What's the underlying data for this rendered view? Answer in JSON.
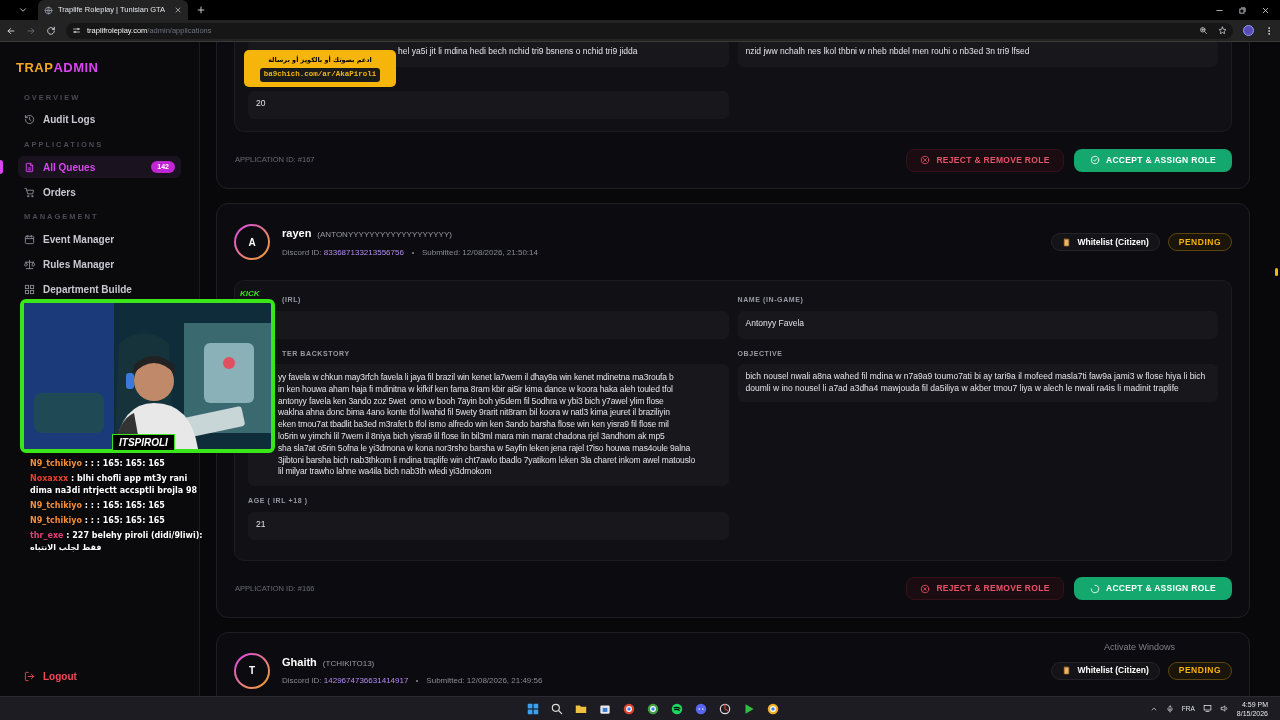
{
  "browser": {
    "tab_title": "Traplife Roleplay | Tunisian GTA",
    "url_host": "traplifroleplay.com",
    "url_path": "/admin/applications"
  },
  "sidebar": {
    "logo": [
      "TRAP",
      "ADMIN"
    ],
    "sections": [
      {
        "title": "OVERVIEW",
        "items": [
          {
            "label": "Audit Logs",
            "selected": false
          }
        ]
      },
      {
        "title": "APPLICATIONS",
        "items": [
          {
            "label": "All Queues",
            "selected": true,
            "badge": "142"
          },
          {
            "label": "Orders",
            "selected": false
          }
        ]
      },
      {
        "title": "MANAGEMENT",
        "items": [
          {
            "label": "Event Manager",
            "selected": false
          },
          {
            "label": "Rules Manager",
            "selected": false
          },
          {
            "label": "Department Builde",
            "selected": false
          }
        ]
      }
    ],
    "logout": "Logout"
  },
  "applications": [
    {
      "fields": [
        {
          "value": "hel ya5i jit li mdina hedi bech nchid tri9 bsnens o nchid tri9 jidda"
        },
        {
          "value": "nzid jww nchalh nes lkol thbni w nheb nbdel men rouhi o nb3ed 3n tri9 lfsed"
        },
        {
          "value": "20"
        }
      ],
      "application_id": "APPLICATION ID: #167",
      "actions": [
        {
          "kind": "reject",
          "label": "REJECT & REMOVE ROLE"
        },
        {
          "kind": "accept",
          "label": "ACCEPT & ASSIGN ROLE",
          "loading": false
        }
      ]
    },
    {
      "initial": "A",
      "name": "rayen",
      "alias": "(ANTONYYYYYYYYYYYYYYYYYYY)",
      "discord_label": "Discord ID:",
      "discord_id": "833687133213556756",
      "submitted": "Submitted: 12/08/2026, 21:50:14",
      "type": "Whitelist (Citizen)",
      "status": "PENDING",
      "fields": [
        {
          "label": "(IRL)"
        },
        {
          "label": "NAME (IN-GAME)",
          "value": "Antonyy Favela"
        },
        {
          "label": "TER BACKSTORY",
          "lines": [
            "yy favela w chkun may3rfch favela li jaya fil brazil win kenet la7wem il dhay9a win kenet mdinetna ma3roufa b",
            "in ken houwa aham haja fi mdinitna w kifkif ken fama 8ram kbir ai5ir kima dance w koora haka aleh touled tfol",
            "antonyy favela ken 3ando zoz 5wet  omo w booh 7ayin boh yi5dem fil 5odhra w ybi3 bich y7awel ylim flose",
            "waklna ahna donc bima 4ano konte tfol lwahid fil 5wety 9rarit nit8ram bil koora w natl3 kima jeuret il braziliyin",
            "eken tmou7at tbadlit ba3ed m3rafet b tfol ismo alfredo win ken 3ando barsha flose win ken yisra9 fil flose mil",
            "lo5rin w yimchi lil 7wem il 8niya bich yisra9 lil flose lin bil3ml mara min marat chadona rjel 3andhom ak mp5",
            "sha sla7at o5rin 5ofna le yi3dmona w kona nor3rsho barsha w 5ayfin leken jena rajel t7iso houwa mas4oule 9alna",
            "3jibtoni barsha bich nab3thkom li mdina traplife win cht7awlo tbadlo 7yatikom leken 3la charet inkom awel matouslo",
            "lil milyar trawho lahne wa4ila bich nab3th wledi yi3dmokom"
          ]
        },
        {
          "label": "OBJECTIVE",
          "value": "bich nousel nwali a8na wahed fil mdina w n7a9a9 toumo7ati bi ay tari9a il mofeed masla7ti faw9a jami3 w flose hiya li bich doumli w ino nousel li a7ad a3dha4 mawjouda fil da5iliya w akber tmou7 liya w alech le nwali ra4is li madinit traplife"
        },
        {
          "label": "AGE ( IRL +18 )",
          "value": "21"
        }
      ],
      "application_id": "APPLICATION ID: #166",
      "actions": [
        {
          "kind": "reject",
          "label": "REJECT & REMOVE ROLE"
        },
        {
          "kind": "accept",
          "label": "ACCEPT & ASSIGN ROLE",
          "loading": true
        }
      ]
    },
    {
      "initial": "T",
      "name": "Ghaith",
      "alias": "(TCHIKITO13)",
      "discord_label": "Discord ID:",
      "discord_id": "1429674736631414917",
      "submitted": "Submitted: 12/08/2026, 21:49:56",
      "type": "Whitelist (Citizen)",
      "status": "PENDING"
    }
  ],
  "stream_overlay": {
    "donation": {
      "text": "ادعم بصوتك أو بالكويز أو برسالة",
      "url": "ba9chich.com/ar/AkaPiroli"
    },
    "webcam_label": "ITSPIROLI",
    "webcam_badge": "KICK",
    "chat": [
      {
        "user": "N9_tchikiyo",
        "color": "#f0903a",
        "message": ": : : 165: 165: 165"
      },
      {
        "user": "Noxaxxx",
        "color": "#e5412f",
        "message": ": blhi chofli app mt3y rani dima na3di ntrjectt accsptli brojla 98"
      },
      {
        "user": "N9_tchikiyo",
        "color": "#f0903a",
        "message": ": : : 165: 165: 165"
      },
      {
        "user": "N9_tchikiyo",
        "color": "#f0903a",
        "message": ": : : 165: 165: 165"
      },
      {
        "user": "thr_exe",
        "color": "#e0407a",
        "message": ": 227 belehy piroli (didi/9liwi): فقط لجلب الانتباه"
      }
    ]
  },
  "watermark_os": "Activate Windows",
  "taskbar": {
    "language": "FRA",
    "time": "4:59 PM",
    "date": "8/15/2026"
  }
}
